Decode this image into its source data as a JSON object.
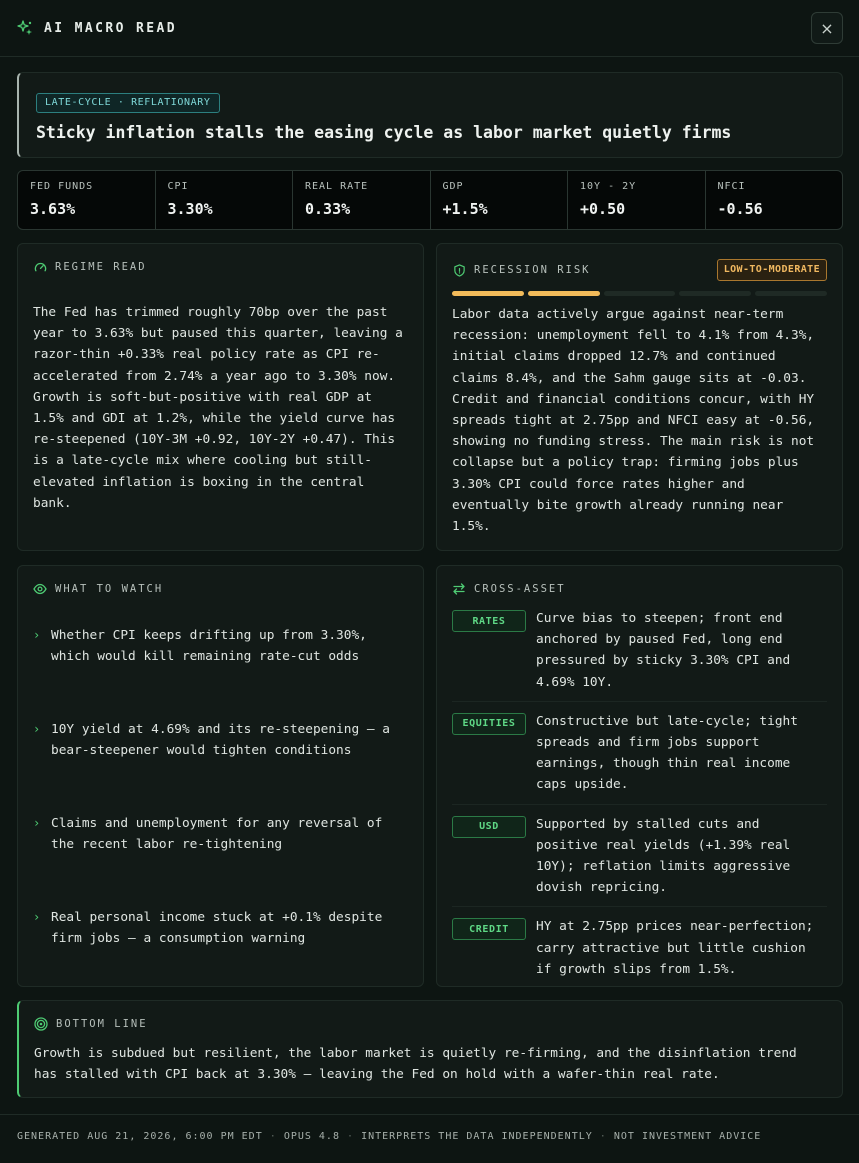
{
  "header": {
    "title": "AI MACRO READ",
    "logo_icon": "sparkle-icon",
    "close_label": "×"
  },
  "headline": {
    "regime_tag": "LATE-CYCLE · REFLATIONARY",
    "text": "Sticky inflation stalls the easing cycle as labor market quietly firms"
  },
  "metrics": [
    {
      "label": "FED FUNDS",
      "value": "3.63%"
    },
    {
      "label": "CPI",
      "value": "3.30%"
    },
    {
      "label": "REAL RATE",
      "value": "0.33%"
    },
    {
      "label": "GDP",
      "value": "+1.5%"
    },
    {
      "label": "10Y - 2Y",
      "value": "+0.50"
    },
    {
      "label": "NFCI",
      "value": "-0.56"
    }
  ],
  "regime_read": {
    "title": "REGIME READ",
    "icon": "gauge-icon",
    "lines": [
      "The Fed has trimmed roughly 70bp over the past",
      "year to 3.63% but paused this quarter, leaving a",
      "razor-thin +0.33% real policy rate as CPI re-",
      "accelerated from 2.74% a year ago to 3.30% now.",
      "Growth is soft-but-positive with real GDP at",
      "1.5% and GDI at 1.2%, while the yield curve has",
      "re-steepened (10Y-3M +0.92, 10Y-2Y +0.47). This",
      "is a late-cycle mix where cooling but still-",
      "elevated inflation is boxing in the central",
      "bank."
    ]
  },
  "recession_risk": {
    "title": "RECESSION RISK",
    "icon": "shield-icon",
    "badge": "LOW-TO-MODERATE",
    "level": 2,
    "max_level": 5,
    "colors": {
      "active": "#f2bb5a",
      "inactive": "#1f2a25"
    },
    "lines": [
      "Labor data actively argue against near-term",
      "recession: unemployment fell to 4.1% from 4.3%,",
      "initial claims dropped 12.7% and continued",
      "claims 8.4%, and the Sahm gauge sits at -0.03.",
      "Credit and financial conditions concur, with HY",
      "spreads tight at 2.75pp and NFCI easy at -0.56,",
      "showing no funding stress. The main risk is not",
      "collapse but a policy trap: firming jobs plus",
      "3.30% CPI could force rates higher and",
      "eventually bite growth already running near",
      "1.5%."
    ]
  },
  "what_to_watch": {
    "title": "WHAT TO WATCH",
    "icon": "eye-icon",
    "items": [
      {
        "chevron": "›",
        "lines": [
          "Whether CPI keeps drifting up from 3.30%,",
          "which would kill remaining rate-cut odds"
        ]
      },
      {
        "chevron": "›",
        "lines": [
          "10Y yield at 4.69% and its re-steepening — a",
          "bear-steepener would tighten conditions"
        ]
      },
      {
        "chevron": "›",
        "lines": [
          "Claims and unemployment for any reversal of",
          "the recent labor re-tightening"
        ]
      },
      {
        "chevron": "›",
        "lines": [
          "Real personal income stuck at +0.1% despite",
          "firm jobs — a consumption warning"
        ]
      }
    ]
  },
  "cross_asset": {
    "title": "CROSS-ASSET",
    "icon": "arrows-swap-icon",
    "items": [
      {
        "tag": "RATES",
        "lines": [
          "Curve bias to steepen; front end",
          "anchored by paused Fed, long end",
          "pressured by sticky 3.30% CPI and",
          "4.69% 10Y."
        ]
      },
      {
        "tag": "EQUITIES",
        "lines": [
          "Constructive but late-cycle; tight",
          "spreads and firm jobs support",
          "earnings, though thin real income",
          "caps upside."
        ]
      },
      {
        "tag": "USD",
        "lines": [
          "Supported by stalled cuts and",
          "positive real yields (+1.39% real",
          "10Y); reflation limits aggressive",
          "dovish repricing."
        ]
      },
      {
        "tag": "CREDIT",
        "lines": [
          "HY at 2.75pp prices near-perfection;",
          "carry attractive but little cushion",
          "if growth slips from 1.5%."
        ]
      }
    ]
  },
  "bottom_line": {
    "title": "BOTTOM LINE",
    "icon": "target-icon",
    "lines": [
      "Growth is subdued but resilient, the labor market is quietly re-firming, and the disinflation trend",
      "has stalled with CPI back at 3.30% — leaving the Fed on hold with a wafer-thin real rate."
    ]
  },
  "footer": {
    "generated": "GENERATED AUG 21, 2026, 6:00 PM EDT",
    "model": "OPUS 4.8",
    "note": "INTERPRETS THE DATA INDEPENDENTLY",
    "disclaimer": "NOT INVESTMENT ADVICE",
    "separator": "·"
  }
}
